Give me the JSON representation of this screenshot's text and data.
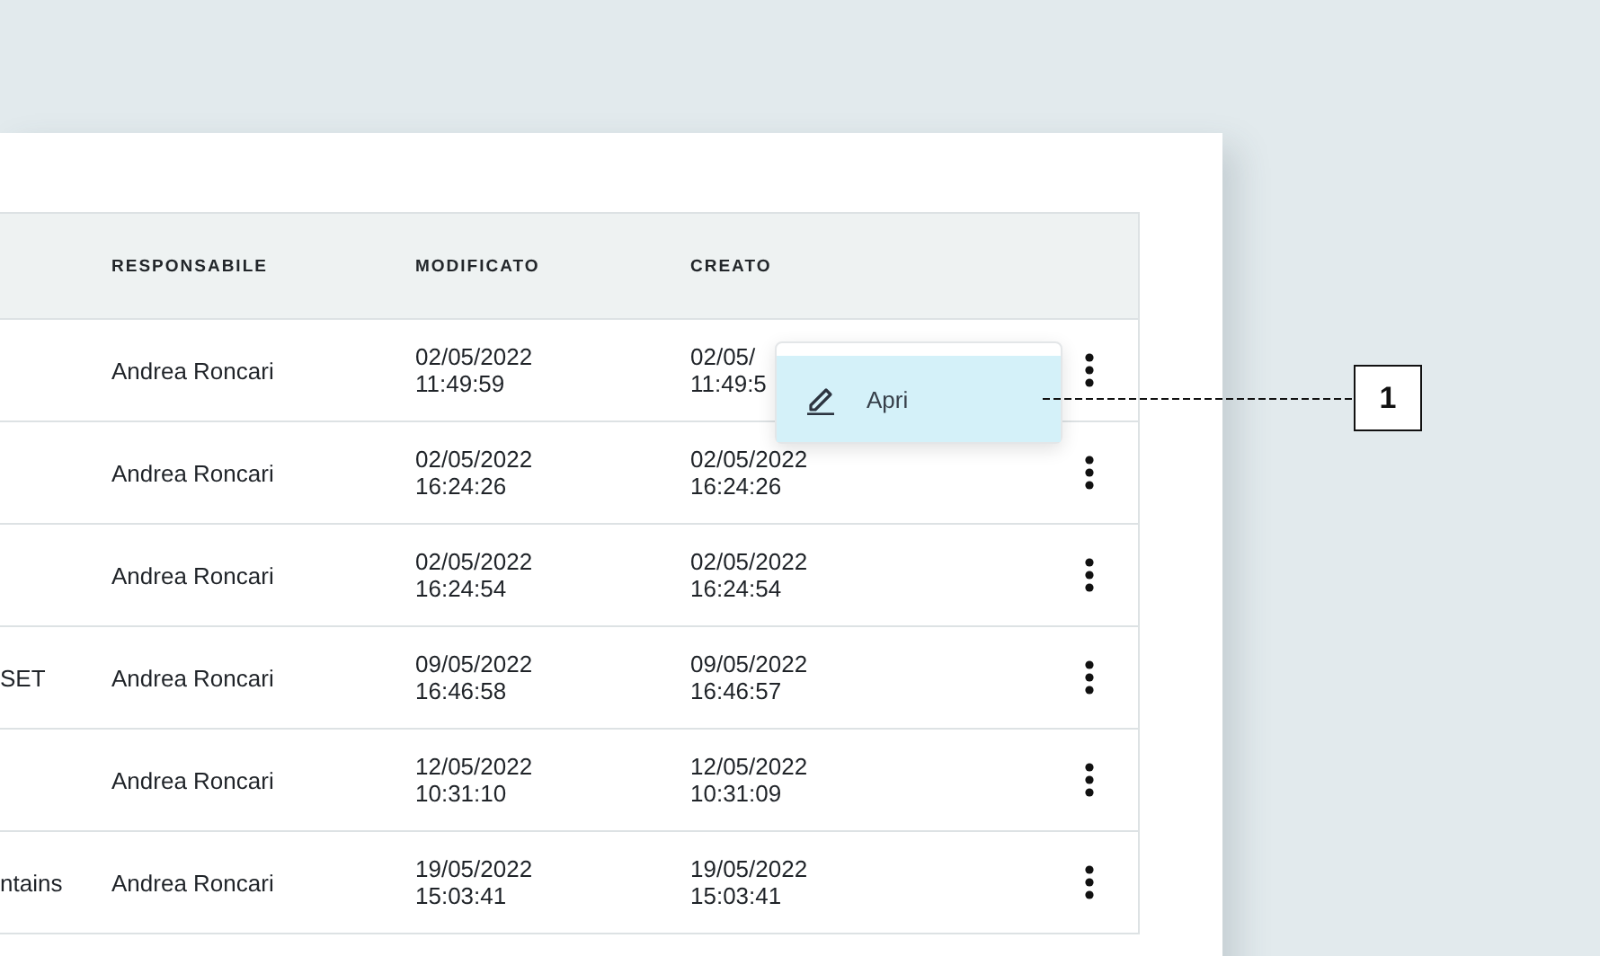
{
  "table": {
    "columns": [
      {
        "label": "RESPONSABILE"
      },
      {
        "label": "MODIFICATO"
      },
      {
        "label": "CREATO"
      }
    ],
    "rows": [
      {
        "column_1": "",
        "responsabile": "Andrea Roncari",
        "modificato": [
          "02/05/2022",
          "11:49:59"
        ],
        "creato": [
          "02/05/",
          "11:49:5"
        ]
      },
      {
        "column_1": "",
        "responsabile": "Andrea Roncari",
        "modificato": [
          "02/05/2022",
          "16:24:26"
        ],
        "creato": [
          "02/05/2022",
          "16:24:26"
        ]
      },
      {
        "column_1": "",
        "responsabile": "Andrea Roncari",
        "modificato": [
          "02/05/2022",
          "16:24:54"
        ],
        "creato": [
          "02/05/2022",
          "16:24:54"
        ]
      },
      {
        "column_1": "SET",
        "responsabile": "Andrea Roncari",
        "modificato": [
          "09/05/2022",
          "16:46:58"
        ],
        "creato": [
          "09/05/2022",
          "16:46:57"
        ]
      },
      {
        "column_1": "",
        "responsabile": "Andrea Roncari",
        "modificato": [
          "12/05/2022",
          "10:31:10"
        ],
        "creato": [
          "12/05/2022",
          "10:31:09"
        ]
      },
      {
        "column_1": "ntains",
        "responsabile": "Andrea Roncari",
        "modificato": [
          "19/05/2022",
          "15:03:41"
        ],
        "creato": [
          "19/05/2022",
          "15:03:41"
        ]
      }
    ]
  },
  "context_menu": {
    "items": [
      {
        "label": "Apri",
        "selected": true
      }
    ]
  },
  "callout": {
    "label": "1"
  }
}
